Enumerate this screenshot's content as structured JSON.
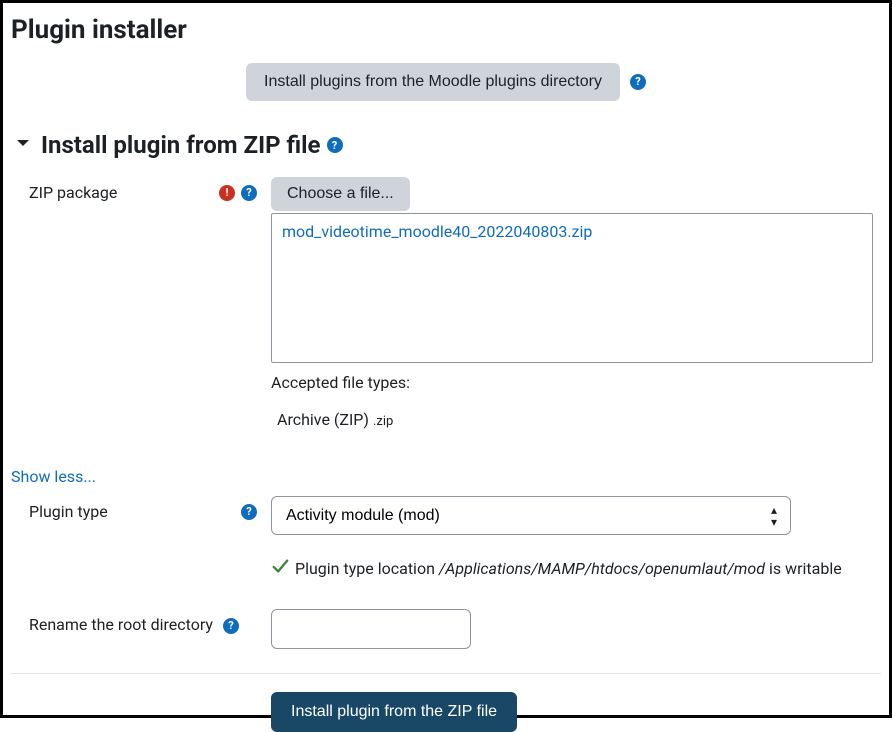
{
  "page": {
    "title": "Plugin installer"
  },
  "top_button": {
    "label": "Install plugins from the Moodle plugins directory"
  },
  "section": {
    "title": "Install plugin from ZIP file"
  },
  "zip_package": {
    "label": "ZIP package",
    "choose_button": "Choose a file...",
    "file_name": "mod_videotime_moodle40_2022040803.zip",
    "accepted_label": "Accepted file types:",
    "accepted_type": "Archive (ZIP)",
    "accepted_ext": ".zip"
  },
  "show_less": "Show less...",
  "plugin_type": {
    "label": "Plugin type",
    "selected": "Activity module (mod)",
    "writable_prefix": "Plugin type location ",
    "writable_path": "/Applications/MAMP/htdocs/openumlaut/mod",
    "writable_suffix": " is writable"
  },
  "rename_dir": {
    "label": "Rename the root directory",
    "value": ""
  },
  "submit": {
    "label": "Install plugin from the ZIP file"
  }
}
